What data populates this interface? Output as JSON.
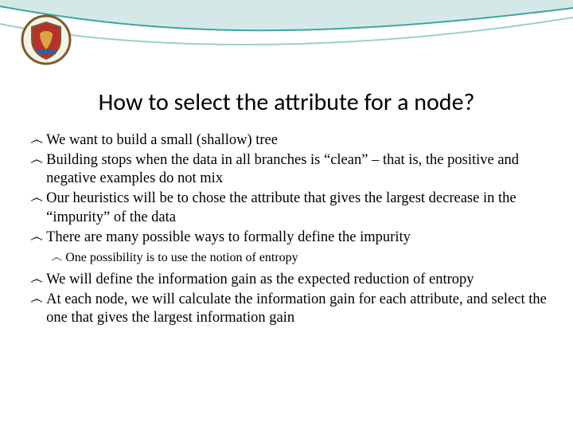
{
  "slide": {
    "title": "How to select the attribute for a node?",
    "bullets": [
      {
        "text": "We want to build a small (shallow) tree",
        "level": 0
      },
      {
        "text": "Building stops when the data in all branches is “clean” – that is, the positive and negative examples do not mix",
        "level": 0
      },
      {
        "text": "Our heuristics will be to chose the attribute that gives the largest decrease in the “impurity” of the data",
        "level": 0
      },
      {
        "text": "There are many possible ways to formally define the impurity",
        "level": 0
      },
      {
        "text": "One possibility is to use the notion of entropy",
        "level": 1
      },
      {
        "text": "We will define the information gain as the expected reduction of entropy",
        "level": 0
      },
      {
        "text": "At each node, we will calculate the information gain for each attribute, and select the one that gives the largest information gain",
        "level": 0
      }
    ],
    "bullet_glyph": "෴"
  }
}
